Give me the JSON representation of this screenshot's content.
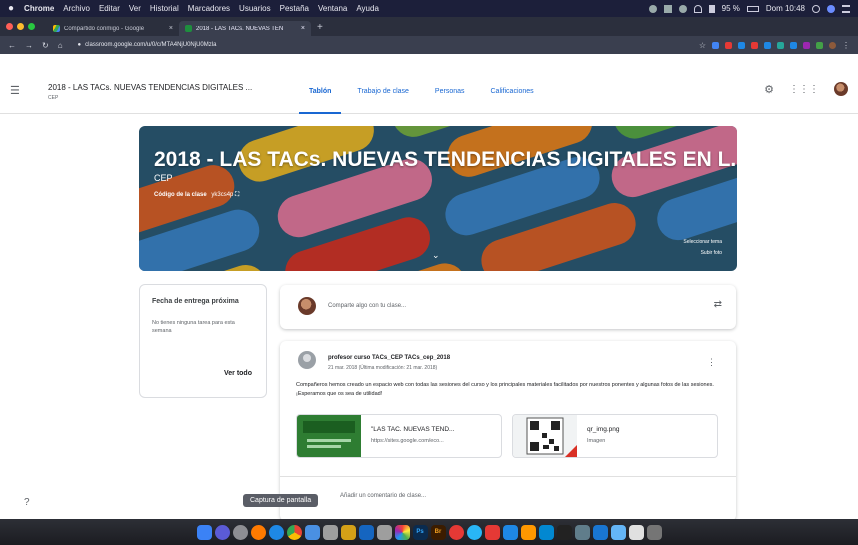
{
  "menubar": {
    "app": "Chrome",
    "items": [
      "Archivo",
      "Editar",
      "Ver",
      "Historial",
      "Marcadores",
      "Usuarios",
      "Pestaña",
      "Ventana",
      "Ayuda"
    ],
    "battery": "95 %",
    "clock": "Dom 10:48"
  },
  "browser": {
    "tabs": [
      {
        "label": "Compartido conmigo - Google",
        "active": false
      },
      {
        "label": "2018 - LAS TACs. NUEVAS TEN",
        "active": true
      }
    ],
    "url": "classroom.google.com/u/0/c/MTA4NjU0NjU0Mzla"
  },
  "header": {
    "class_title": "2018 - LAS TACs. NUEVAS TENDENCIAS DIGITALES ...",
    "class_section": "CEP",
    "tabs": [
      "Tablón",
      "Trabajo de clase",
      "Personas",
      "Calificaciones"
    ]
  },
  "banner": {
    "title": "2018 - LAS TACs. NUEVAS TENDENCIAS DIGITALES EN L...",
    "section": "CEP",
    "code_label": "Código de la clase",
    "code_value": "yk3cs4p",
    "select_theme": "Seleccionar tema",
    "upload_photo": "Subir foto"
  },
  "upcoming": {
    "title": "Fecha de entrega próxima",
    "body": "No tienes ninguna tarea para esta semana",
    "link": "Ver todo"
  },
  "share": {
    "placeholder": "Comparte algo con tu clase..."
  },
  "post": {
    "author": "profesor curso TACs_CEP TACs_cep_2018",
    "date": "21 mar. 2018 (Última modificación: 21 mar. 2018)",
    "message": "Compañeros hemos creado un espacio web con todas las sesiones del curso y los principales materiales facilitados por nuestros ponentes y algunas fotos de las sesiones. ¡Esperamos que os sea de utilidad!",
    "attachments": [
      {
        "title": "\"LAS TAC. NUEVAS TEND...",
        "sub": "https://sites.google.com/eco..."
      },
      {
        "title": "qr_img.png",
        "sub": "Imagen"
      }
    ],
    "comment_placeholder": "Añadir un comentario de clase..."
  },
  "tooltip": "Captura de pantalla",
  "dock_labels": [
    "Ps",
    "Br"
  ],
  "colors": {
    "accent": "#1967d2",
    "dock": "#1b1c21"
  }
}
